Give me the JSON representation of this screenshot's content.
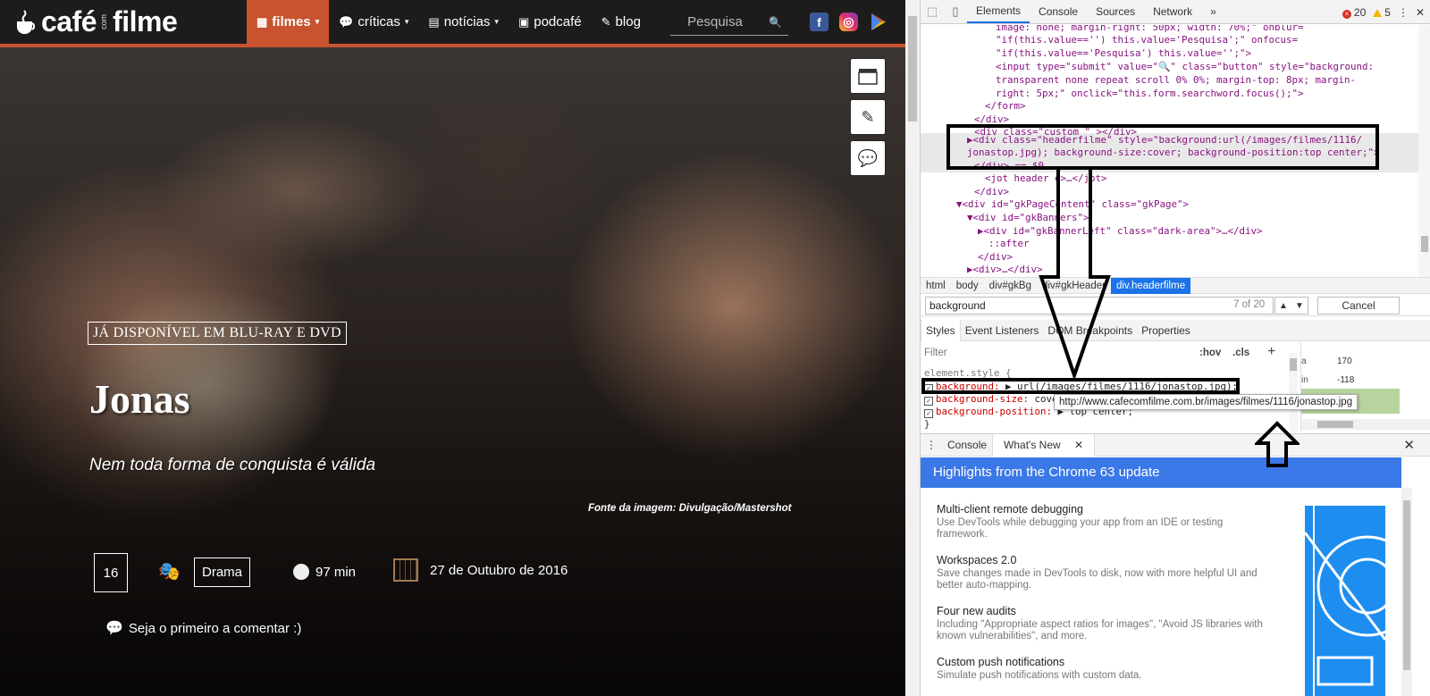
{
  "site": {
    "logo": {
      "word1": "café",
      "word2": "com",
      "word3": "filme"
    },
    "nav": [
      {
        "icon": "clapper",
        "label": "filmes",
        "caret": "▾"
      },
      {
        "icon": "speech",
        "label": "críticas",
        "caret": "▾"
      },
      {
        "icon": "newspaper",
        "label": "notícias",
        "caret": "▾"
      },
      {
        "icon": "radio",
        "label": "podcafé",
        "caret": ""
      },
      {
        "icon": "edit",
        "label": "blog",
        "caret": ""
      }
    ],
    "search_placeholder": "Pesquisa",
    "availability": "JÁ DISPONÍVEL EM BLU-RAY E DVD",
    "title": "Jonas",
    "tagline": "Nem toda forma de conquista é válida",
    "image_credit": "Fonte da imagem: Divulgação/Mastershot",
    "age_rating": "16",
    "genre": "Drama",
    "duration": "97 min",
    "release_date": "27 de Outubro de 2016",
    "comments": "Seja o primeiro a comentar :)",
    "brand_color": "#c8532e"
  },
  "devtools": {
    "tabs": [
      "Elements",
      "Console",
      "Sources",
      "Network"
    ],
    "more": "»",
    "errors": "20",
    "warnings": "5",
    "dom_lines": [
      "image: none; margin-right: 50px; width: 70%;\" onblur=",
      "\"if(this.value=='') this.value='Pesquisa';\" onfocus=",
      "\"if(this.value=='Pesquisa') this.value='';\">",
      "<input type=\"submit\" value=\"🔍\" class=\"button\" style=\"background:",
      "transparent none repeat scroll 0% 0%; margin-top: 8px; margin-",
      "right: 5px;\" onclick=\"this.form.searchword.focus();\">",
      "</form>",
      "</div>",
      "<div class=\"custom \" ></div>",
      "▶<div class=\"headerfilme\" style=\"background:url(/images/filmes/1116/",
      "jonastop.jpg); background-size:cover; background-position:top center;\">",
      "</div> == $0",
      "<jot header e>…</jot>",
      "</div>",
      "▼<div id=\"gkPageContent\" class=\"gkPage\">",
      "▼<div id=\"gkBanners\">",
      "▶<div id=\"gkBannerLeft\" class=\"dark-area\">…</div>",
      "::after",
      "</div>",
      "▶<div>…</div>"
    ],
    "breadcrumbs": [
      "html",
      "body",
      "div#gkBg",
      "div#gkHeader",
      "div.headerfilme"
    ],
    "search_value": "background",
    "search_count": "7 of 20",
    "cancel": "Cancel",
    "subtabs": [
      "Styles",
      "Event Listeners",
      "DOM Breakpoints",
      "Properties"
    ],
    "filter": "Filter",
    "hov": ":hov",
    "cls": ".cls",
    "rules": {
      "selector": "element.style {",
      "p1_name": "background:",
      "p1_value": "▶ url(/images/filmes/1116/jonastop.jpg);",
      "p2_name": "background-size:",
      "p2_value": "cover;",
      "p3_name": "background-position:",
      "p3_value": "▶ top center;",
      "close": "}"
    },
    "box_values": [
      "170",
      "-118"
    ],
    "box_labels": [
      "a",
      "in"
    ],
    "tooltip": "http://www.cafecomfilme.com.br/images/filmes/1116/jonastop.jpg",
    "drawer_tabs": [
      "Console",
      "What's New"
    ],
    "whats_new_title": "Highlights from the Chrome 63 update",
    "whats_new_items": [
      {
        "title": "Multi-client remote debugging",
        "desc": "Use DevTools while debugging your app from an IDE or testing framework."
      },
      {
        "title": "Workspaces 2.0",
        "desc": "Save changes made in DevTools to disk, now with more helpful UI and better auto-mapping."
      },
      {
        "title": "Four new audits",
        "desc": "Including \"Appropriate aspect ratios for images\", \"Avoid JS libraries with known vulnerabilities\", and more."
      },
      {
        "title": "Custom push notifications",
        "desc": "Simulate push notifications with custom data."
      }
    ],
    "accent": "#1a73e8",
    "banner_color": "#3b78e7"
  }
}
